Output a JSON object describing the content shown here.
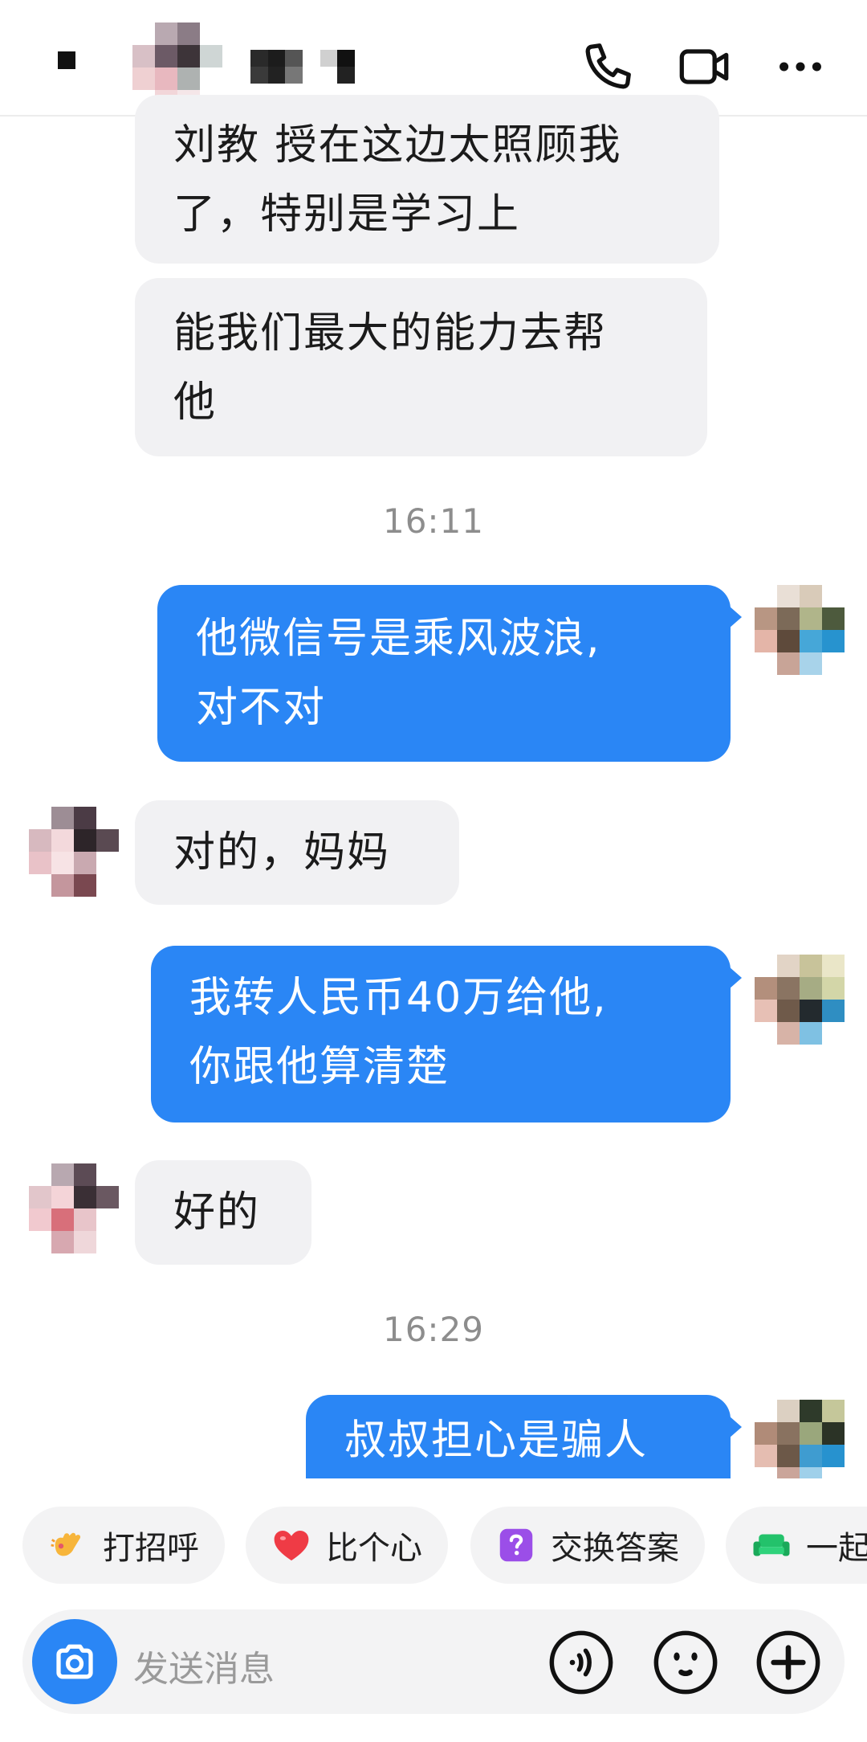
{
  "header": {
    "back_icon": "back-icon",
    "avatar": "blurred-contact-avatar",
    "name_blurred": true,
    "actions": [
      "phone-icon",
      "video-call-icon",
      "more-icon"
    ]
  },
  "messages": [
    {
      "side": "in",
      "lines": [
        "刘教 授在这边太照顾我",
        "了，特别是学习上"
      ]
    },
    {
      "side": "in",
      "lines": [
        "能我们最大的能力去帮",
        "他"
      ]
    },
    {
      "type": "time",
      "text": "16:11"
    },
    {
      "side": "out",
      "lines": [
        "他微信号是乘风波浪,",
        "对不对"
      ]
    },
    {
      "side": "in",
      "lines": [
        "对的，妈妈"
      ]
    },
    {
      "side": "out",
      "lines": [
        "我转人民币40万给他,",
        "你跟他算清楚"
      ]
    },
    {
      "side": "in",
      "lines": [
        "好的"
      ]
    },
    {
      "type": "time",
      "text": "16:29"
    },
    {
      "side": "out",
      "lines": [
        "叔叔担心是骗人"
      ]
    }
  ],
  "quick_actions": [
    {
      "label": "打招呼",
      "icon": "wave-hand-icon"
    },
    {
      "label": "比个心",
      "icon": "heart-icon"
    },
    {
      "label": "交换答案",
      "icon": "question-icon"
    },
    {
      "label": "一起",
      "icon": "sofa-icon"
    }
  ],
  "input": {
    "placeholder": "发送消息",
    "icons": [
      "camera-icon",
      "voice-icon",
      "emoji-icon",
      "plus-icon"
    ]
  },
  "colors": {
    "accent": "#2a86f5",
    "incoming_bubble": "#f1f1f3",
    "timestamp": "#8d8d8d"
  }
}
